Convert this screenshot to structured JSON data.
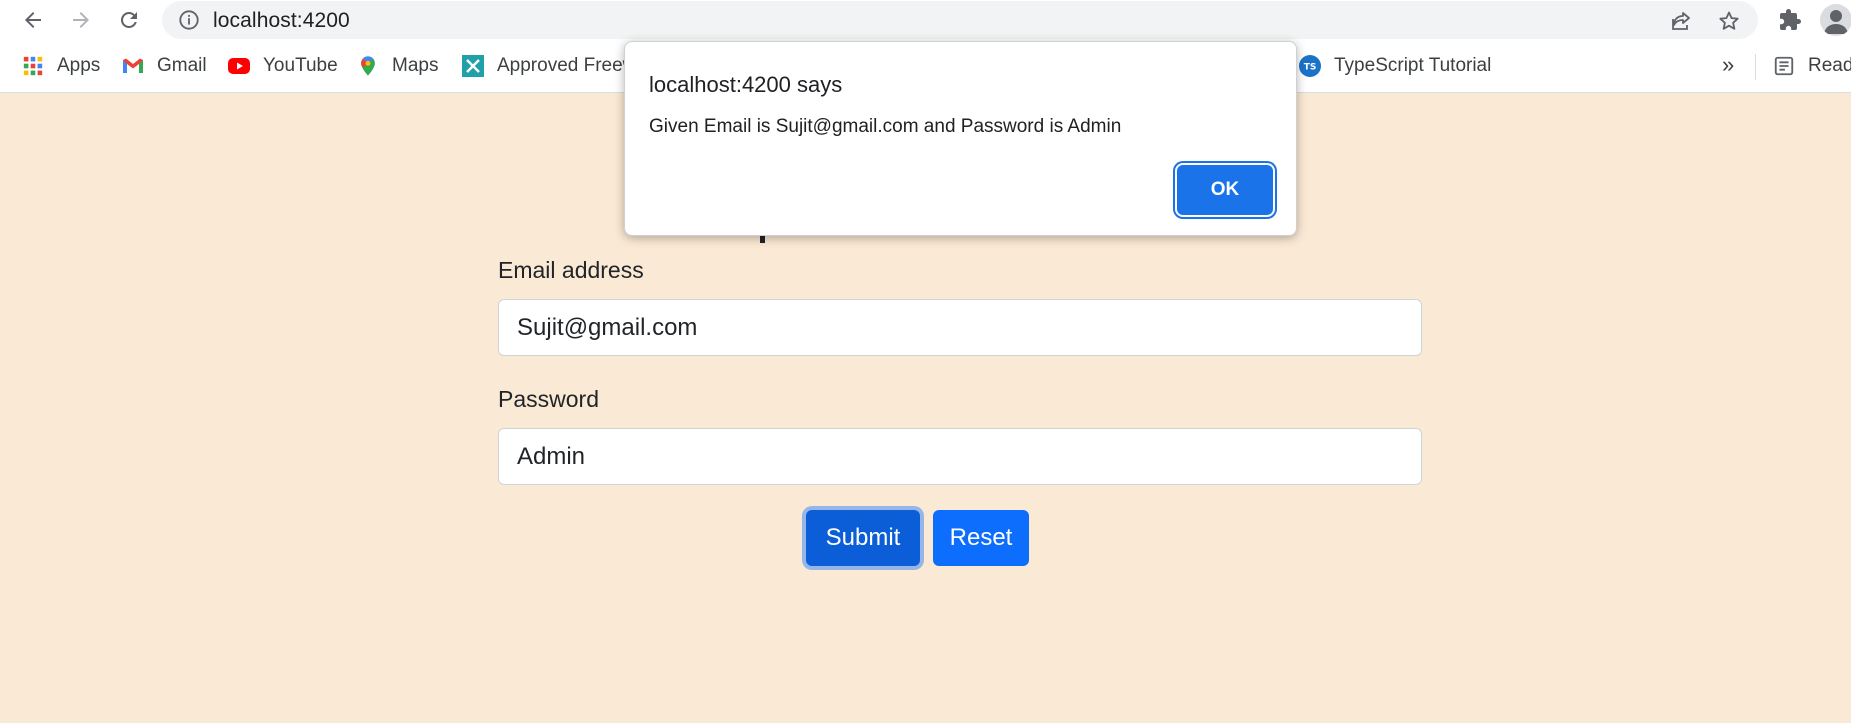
{
  "browser": {
    "url": "localhost:4200"
  },
  "bookmarks": [
    {
      "label": "Apps",
      "icon": "apps-grid-icon"
    },
    {
      "label": "Gmail",
      "icon": "gmail-icon"
    },
    {
      "label": "YouTube",
      "icon": "youtube-icon"
    },
    {
      "label": "Maps",
      "icon": "maps-icon"
    },
    {
      "label": "Approved Freew",
      "icon": "bookmark-site-icon"
    },
    {
      "label": "TypeScript Tutorial",
      "icon": "typescript-icon"
    },
    {
      "label": "Readi",
      "icon": "reading-list-icon"
    }
  ],
  "bookmarks_overflow": "»",
  "form": {
    "email_label": "Email address",
    "email_value": "Sujit@gmail.com",
    "password_label": "Password",
    "password_value": "Admin",
    "submit_label": "Submit",
    "reset_label": "Reset"
  },
  "dialog": {
    "title": "localhost:4200 says",
    "message": "Given Email is Sujit@gmail.com and Password is Admin",
    "ok_label": "OK"
  },
  "colors": {
    "page_background": "#fae9d4",
    "primary_button": "#0d6efd",
    "dialog_ok": "#1a73e8"
  }
}
